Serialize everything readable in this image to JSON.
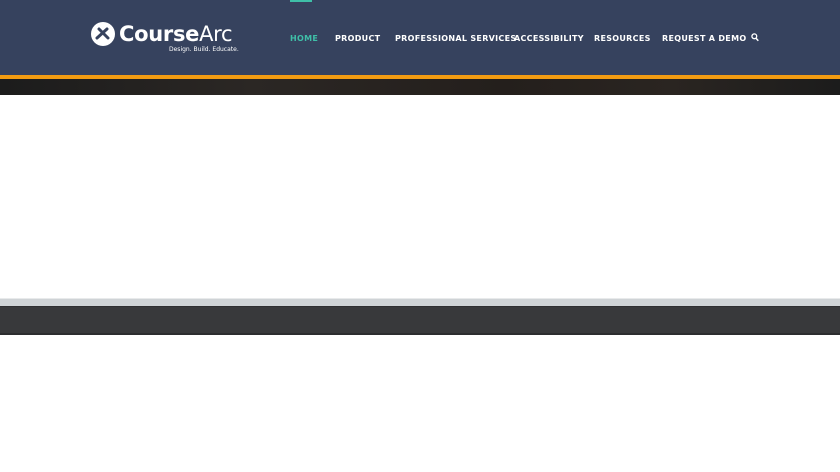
{
  "brand": {
    "name_bold": "Course",
    "name_light": "Arc",
    "tagline": "Design. Build. Educate."
  },
  "nav": {
    "items": [
      {
        "label": "HOME",
        "active": true
      },
      {
        "label": "PRODUCT"
      },
      {
        "label": "PROFESSIONAL SERVICES"
      },
      {
        "label": "ACCESSIBILITY"
      },
      {
        "label": "RESOURCES"
      },
      {
        "label": "REQUEST A DEMO"
      }
    ],
    "search_icon": "search-icon"
  },
  "colors": {
    "header": "#36425e",
    "accent": "#3fbfa8",
    "stripe": "#f39c12",
    "footer": "#38393b"
  }
}
